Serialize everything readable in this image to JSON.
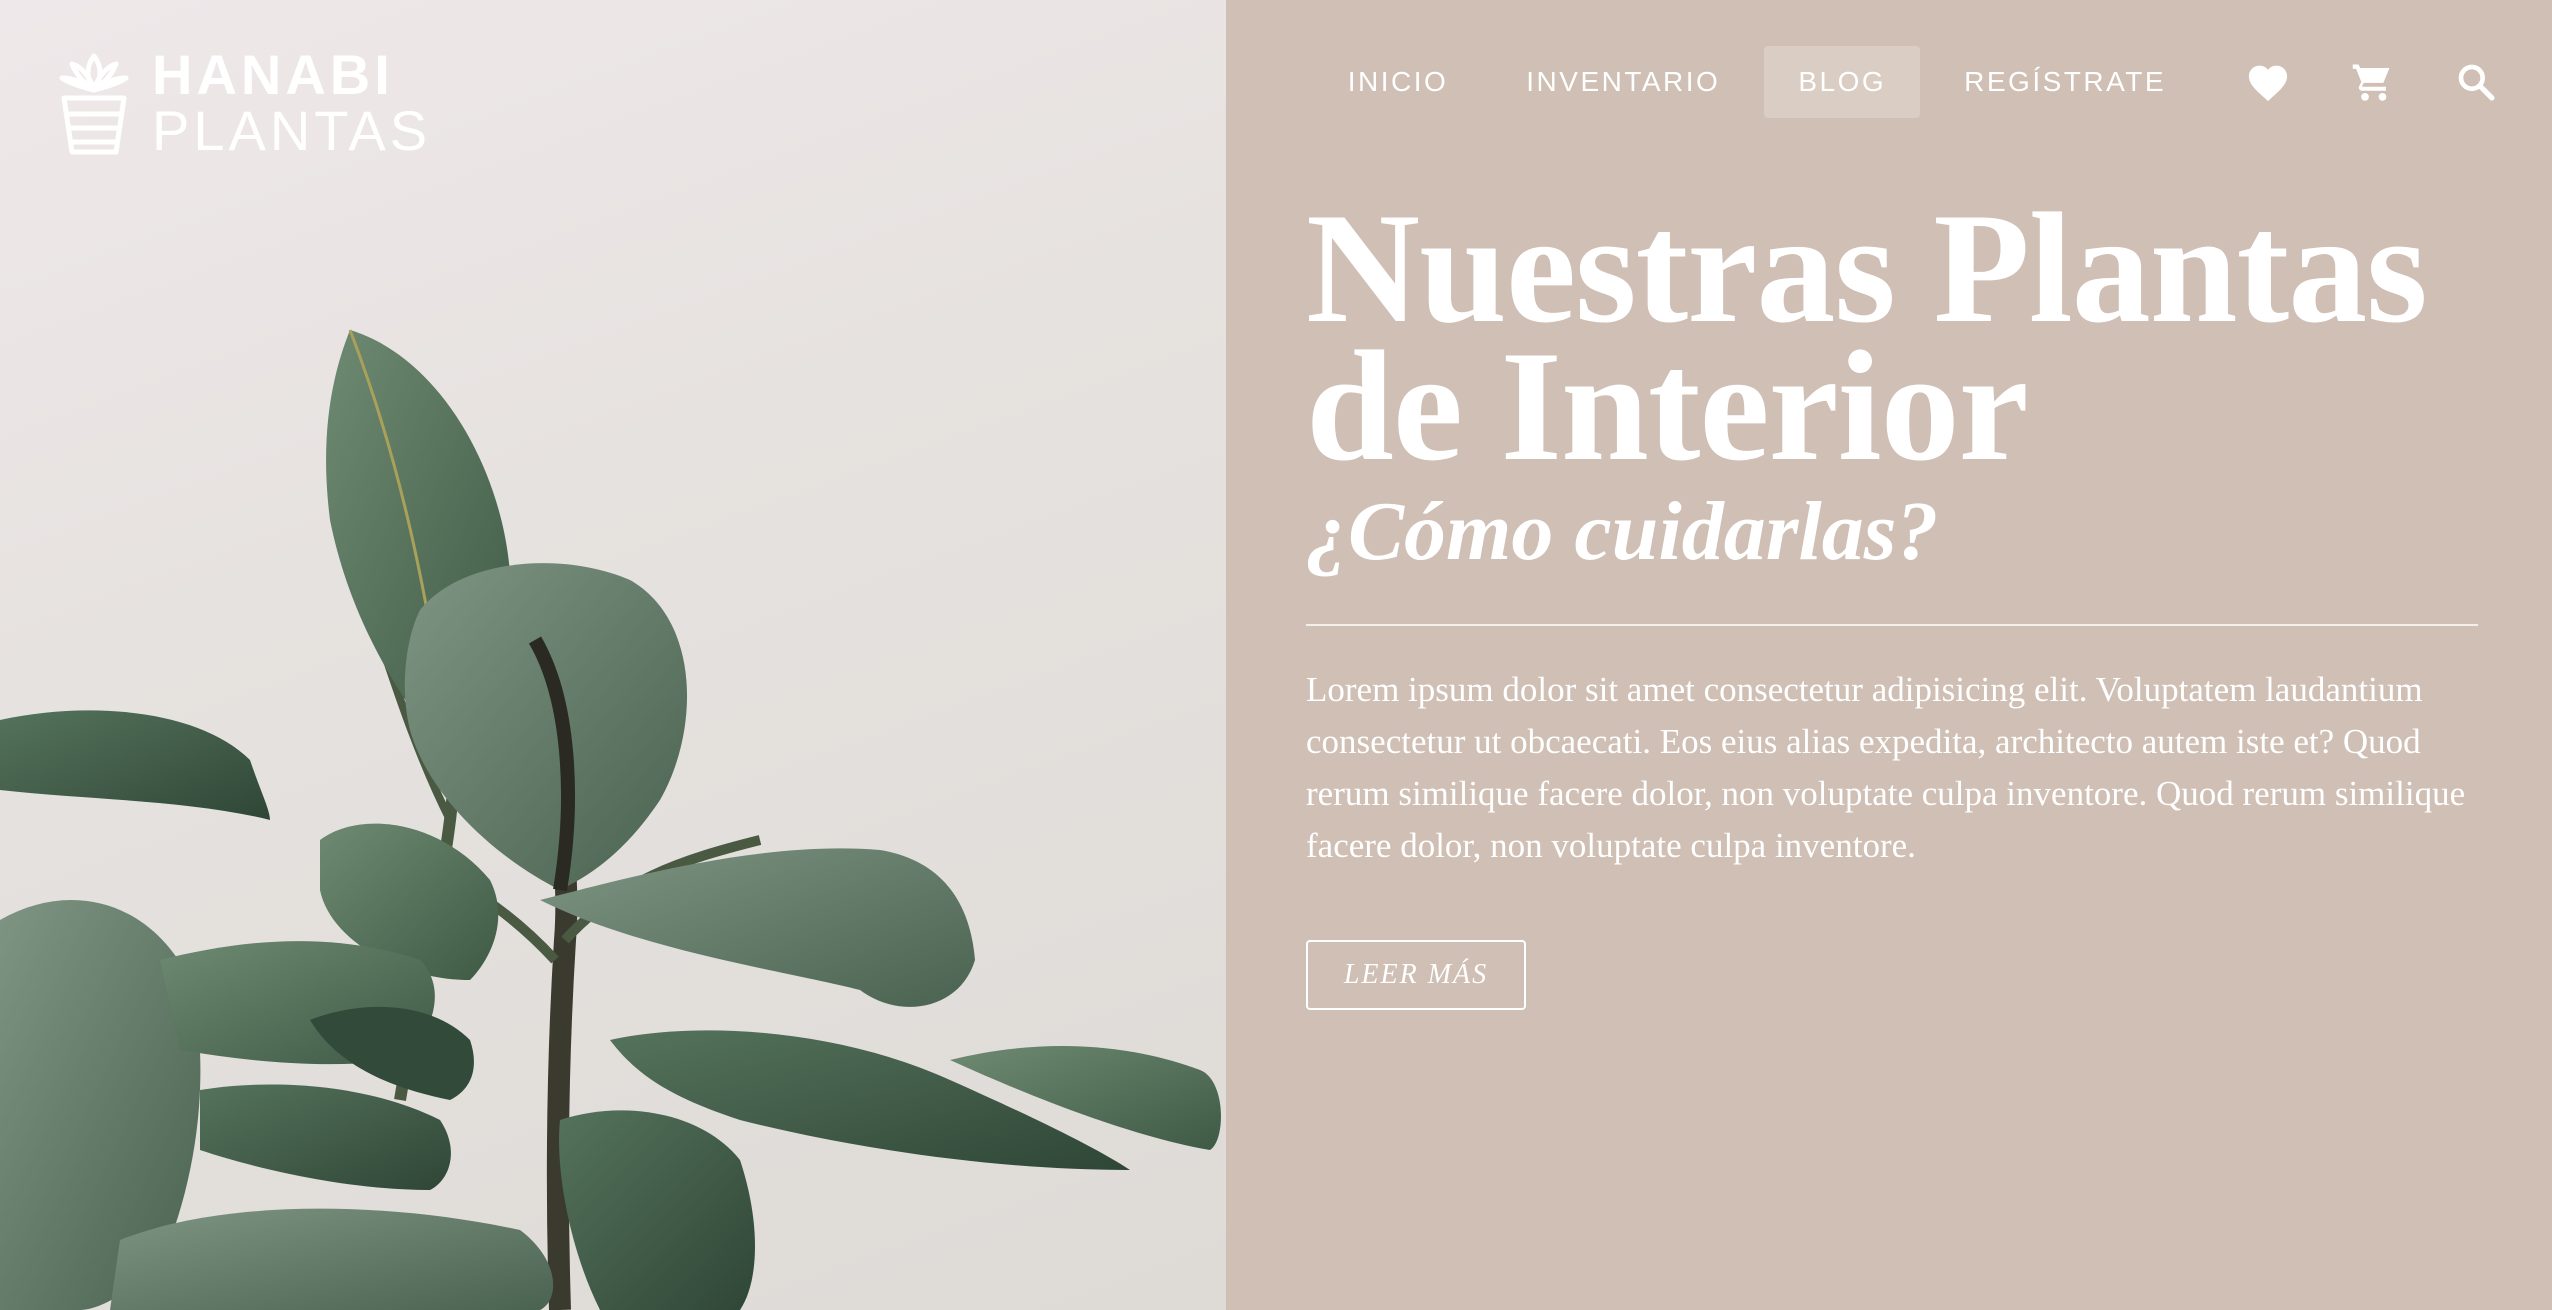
{
  "brand": {
    "line1": "HANABI",
    "line2": "PLANTAS",
    "logo_icon": "plant-pot-icon"
  },
  "nav": {
    "items": [
      {
        "label": "INICIO",
        "active": false
      },
      {
        "label": "INVENTARIO",
        "active": false
      },
      {
        "label": "BLOG",
        "active": true
      },
      {
        "label": "REGÍSTRATE",
        "active": false
      }
    ],
    "icons": [
      "heart-icon",
      "cart-icon",
      "search-icon"
    ]
  },
  "hero": {
    "title": "Nuestras Plantas de Interior",
    "subtitle": "¿Cómo cuidarlas?",
    "body": "Lorem ipsum dolor sit amet consectetur adipisicing elit. Voluptatem laudantium consectetur ut obcaecati. Eos eius alias expedita, architecto autem iste et? Quod rerum similique facere dolor, non voluptate culpa inventore. Quod rerum similique facere dolor, non voluptate culpa inventore.",
    "cta_label": "LEER MÁS",
    "image": "rubber-plant-photo"
  },
  "colors": {
    "panel_bg": "#cfbfb4",
    "text": "#ffffff",
    "leaf": "#4f6b55"
  }
}
